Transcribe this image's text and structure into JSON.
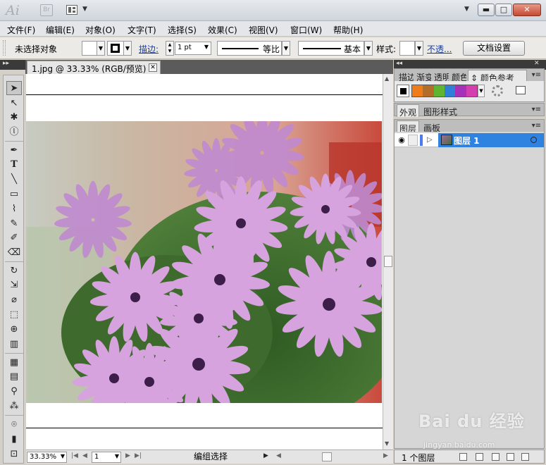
{
  "app": {
    "logo": "Ai",
    "bridge": "Br"
  },
  "window": {
    "minimize": "▬",
    "maximize": "□",
    "close": "✕"
  },
  "menu": [
    "文件(F)",
    "编辑(E)",
    "对象(O)",
    "文字(T)",
    "选择(S)",
    "效果(C)",
    "视图(V)",
    "窗口(W)",
    "帮助(H)"
  ],
  "control": {
    "selection_status": "未选择对象",
    "stroke_label": "描边:",
    "stroke_weight": "1 pt",
    "profile_label": "等比",
    "brush_label": "基本",
    "style_label": "样式:",
    "opacity_link": "不透...",
    "doc_settings": "文档设置"
  },
  "document": {
    "tab_title": "1.jpg @ 33.33% (RGB/预览)"
  },
  "status": {
    "zoom": "33.33%",
    "artboard": "1",
    "mode": "编组选择"
  },
  "panels": {
    "color_tabs": [
      "描边",
      "渐变",
      "透明",
      "颜色",
      "颜色参考"
    ],
    "appearance_tabs": [
      "外观",
      "图形样式"
    ],
    "layers_tabs": [
      "图层",
      "画板"
    ],
    "layer_name": "图层 1",
    "layer_count": "1 个图层"
  },
  "harmony_colors": [
    "#ef7c1b",
    "#b26d2a",
    "#5fb52f",
    "#2f7fd6",
    "#a431b8",
    "#d43fb0"
  ],
  "watermark": {
    "brand": "Bai du 经验",
    "sub": "jingyan.baidu.com"
  }
}
